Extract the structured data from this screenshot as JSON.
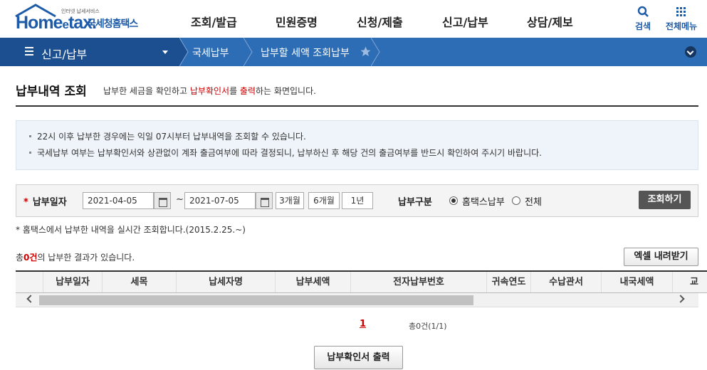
{
  "header": {
    "logo_small": "인터넷 납세서비스",
    "logo_text_main": "Home",
    "logo_text_e": "e",
    "logo_text_tail": "tax.",
    "logo_kr": "국세청홈택스",
    "nav": [
      "조회/발급",
      "민원증명",
      "신청/제출",
      "신고/납부",
      "상담/제보"
    ],
    "search_label": "검색",
    "allmenu_label": "전체메뉴"
  },
  "bluebar": {
    "menu_label": "신고/납부",
    "crumbs": [
      "국세납부",
      "납부할 세액 조회납부"
    ]
  },
  "page": {
    "title": "납부내역 조회",
    "desc_pre": "납부한 세금을 확인하고 ",
    "desc_red1": "납부확인서",
    "desc_mid": "를 ",
    "desc_red2": "출력",
    "desc_post": "하는 화면입니다."
  },
  "notice": [
    "22시 이후 납부한 경우에는 익일 07시부터 납부내역을 조회할 수 있습니다.",
    "국세납부 여부는 납부확인서와 상관없이 계좌 출금여부에 따라 결정되니, 납부하신 후 해당 건의 출금여부를 반드시 확인하여 주시기 바랍니다."
  ],
  "search": {
    "date_label": "납부일자",
    "date_from": "2021-04-05",
    "tilde": "~",
    "date_to": "2021-07-05",
    "periods": [
      "3개월",
      "6개월",
      "1년"
    ],
    "type_label": "납부구분",
    "type_options": [
      "홈택스납부",
      "전체"
    ],
    "type_selected": "홈택스납부",
    "query_label": "조회하기"
  },
  "realtime_note": "* 홈택스에서 납부한 내역을 실시간 조회합니다.(2015.2.25.~)",
  "result": {
    "prefix": "총",
    "count": "0건",
    "suffix": "의 납부한 결과가 있습니다.",
    "excel_label": "엑셀 내려받기"
  },
  "grid": {
    "columns": [
      "",
      "납부일자",
      "세목",
      "납세자명",
      "납부세액",
      "전자납부번호",
      "귀속연도",
      "수납관서",
      "내국세액",
      "교"
    ]
  },
  "pager": {
    "current": "1",
    "total": "총0건(1/1)"
  },
  "print_label": "납부확인서 출력",
  "colors": {
    "brand_blue": "#1d5ba8",
    "bar_blue": "#2d6db5",
    "bar_dark": "#1b4f8f",
    "accent_red": "#cc0000"
  }
}
